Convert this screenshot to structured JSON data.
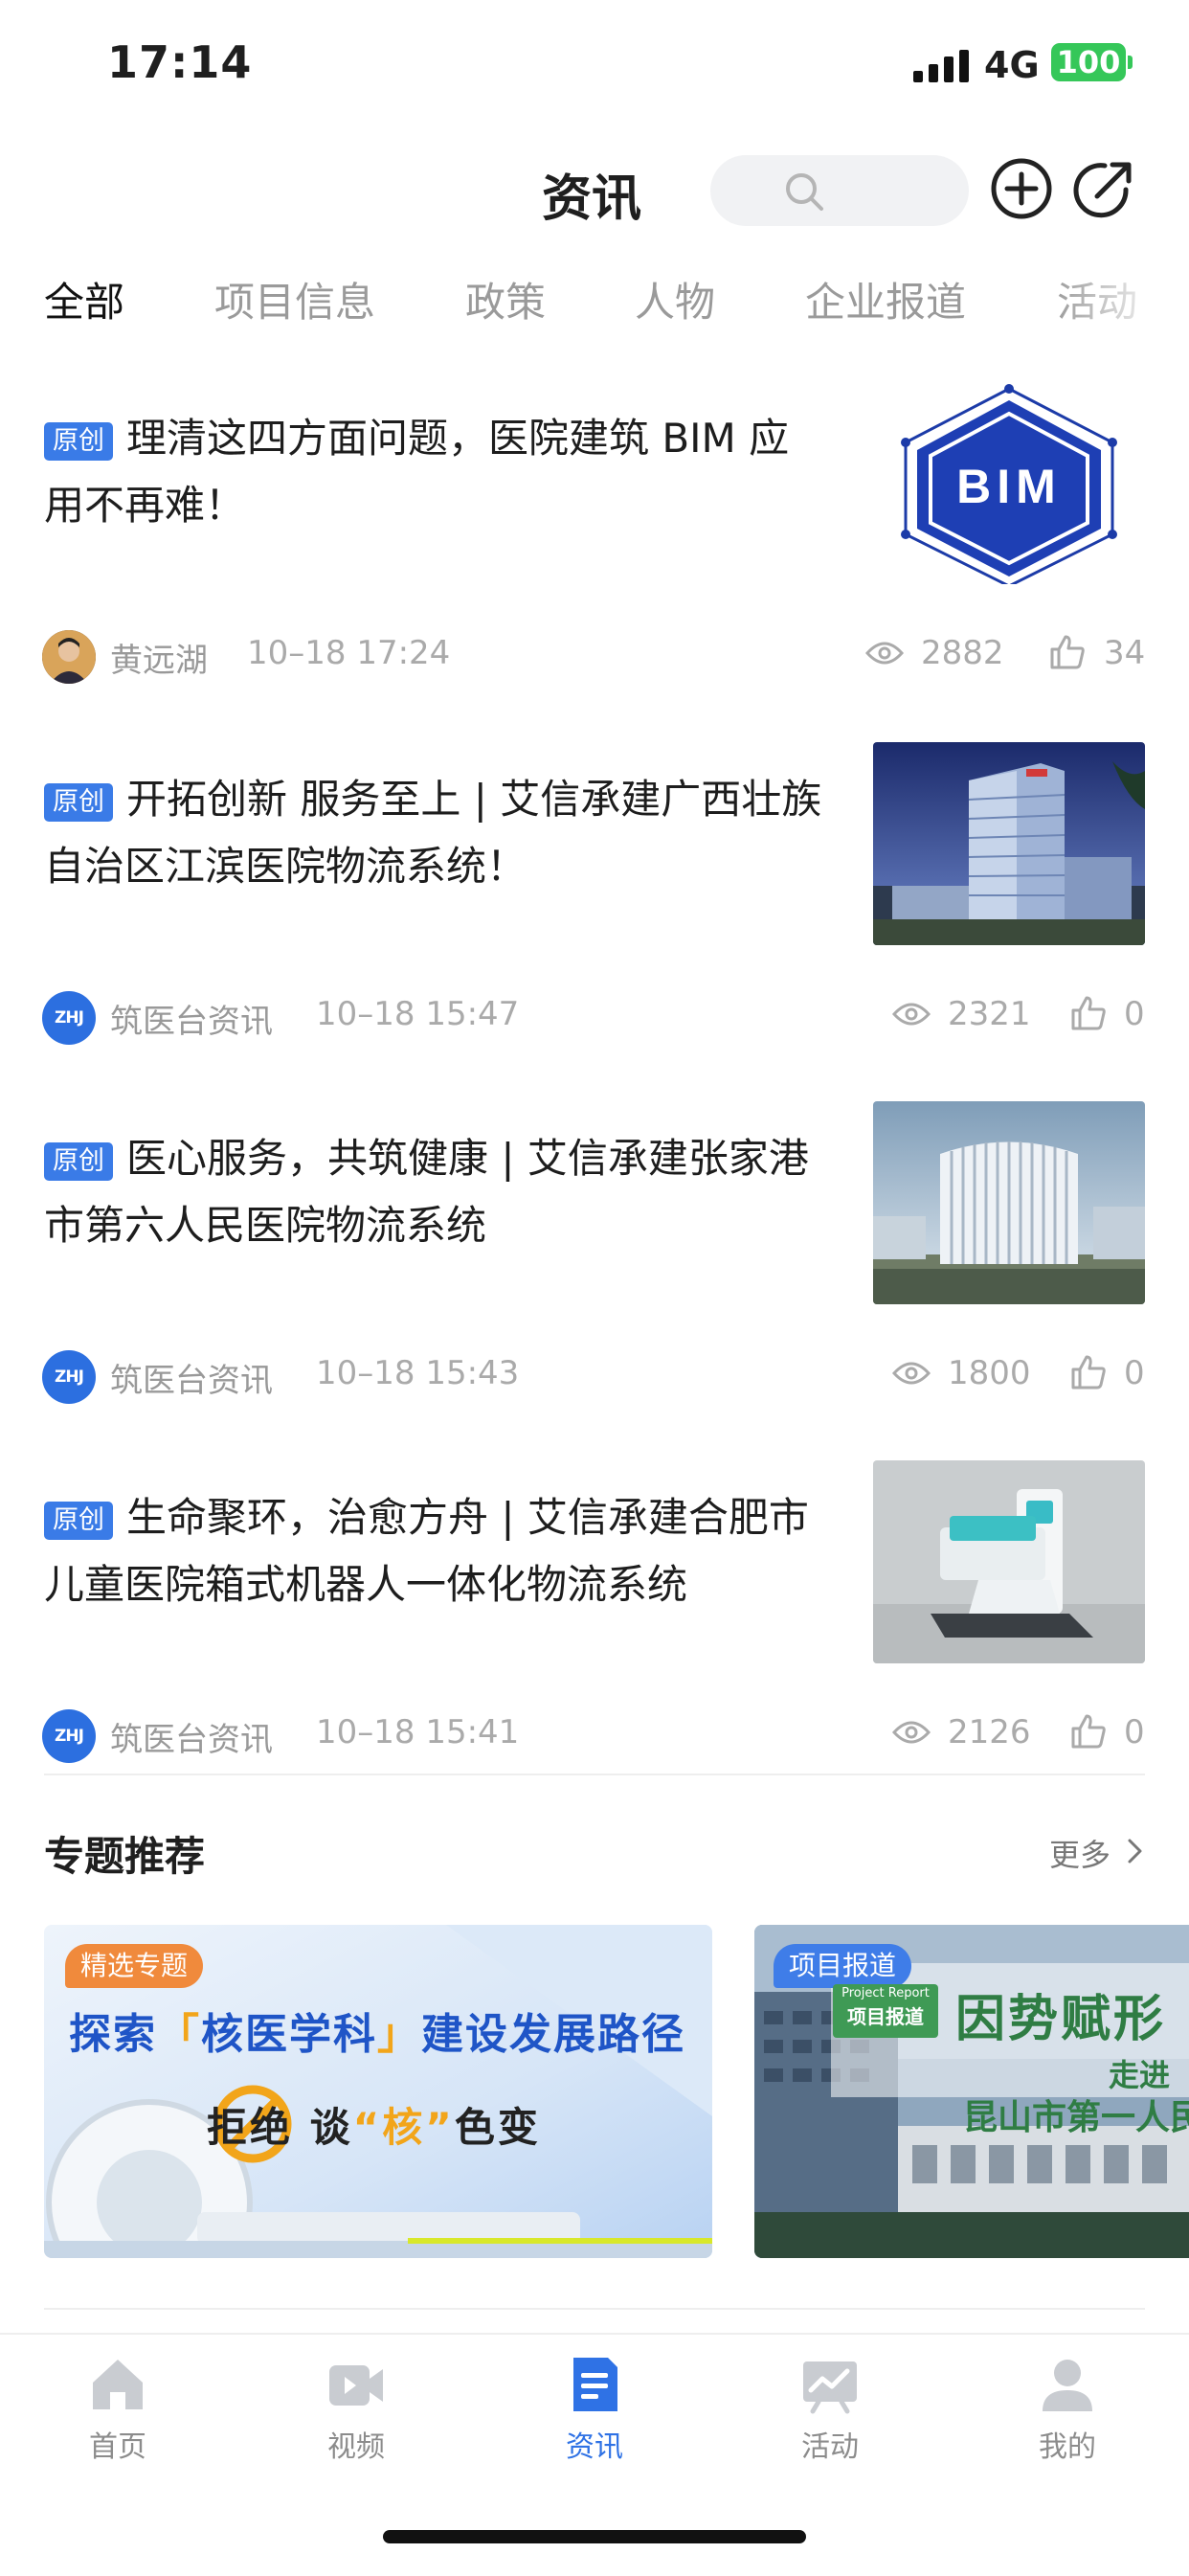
{
  "status_bar": {
    "time": "17:14",
    "network": "4G",
    "battery": "100"
  },
  "header": {
    "title": "资讯",
    "search_placeholder": ""
  },
  "tabs": [
    {
      "label": "全部",
      "active": true
    },
    {
      "label": "项目信息"
    },
    {
      "label": "政策"
    },
    {
      "label": "人物"
    },
    {
      "label": "企业报道"
    },
    {
      "label": "活动"
    }
  ],
  "articles": [
    {
      "badge": "原创",
      "title": "理清这四方面问题，医院建筑 BIM 应用不再难！",
      "author": "黄远湖",
      "time": "10–18 17:24",
      "views": "2882",
      "likes": "34",
      "thumb_text": "BIM"
    },
    {
      "badge": "原创",
      "title": "开拓创新 服务至上 | 艾信承建广西壮族自治区江滨医院物流系统！",
      "author": "筑医台资讯",
      "time": "10–18 15:47",
      "views": "2321",
      "likes": "0"
    },
    {
      "badge": "原创",
      "title": "医心服务，共筑健康 | 艾信承建张家港市第六人民医院物流系统",
      "author": "筑医台资讯",
      "time": "10–18 15:43",
      "views": "1800",
      "likes": "0"
    },
    {
      "badge": "原创",
      "title": "生命聚环，治愈方舟 | 艾信承建合肥市儿童医院箱式机器人一体化物流系统",
      "author": "筑医台资讯",
      "time": "10–18 15:41",
      "views": "2126",
      "likes": "0"
    }
  ],
  "avatar_logo_text": "ZHJ",
  "section": {
    "title": "专题推荐",
    "more": "更多"
  },
  "topics": [
    {
      "badge": "精选专题",
      "headline_pre": "探索",
      "headline_key": "核医学科",
      "headline_post": "建设发展路径",
      "subline_pre": "拒绝 谈",
      "subline_key": "核",
      "subline_post": "色变"
    },
    {
      "badge": "项目报道",
      "tag_en": "Project Report",
      "tag_cn": "项目报道",
      "headline": "因势赋形",
      "sub1": "走进",
      "sub2": "昆山市第一人民"
    }
  ],
  "bottom_nav": [
    {
      "label": "首页",
      "icon": "home-icon"
    },
    {
      "label": "视频",
      "icon": "video-icon"
    },
    {
      "label": "资讯",
      "icon": "news-icon",
      "active": true
    },
    {
      "label": "活动",
      "icon": "activity-icon"
    },
    {
      "label": "我的",
      "icon": "profile-icon"
    }
  ],
  "colors": {
    "accent": "#2f72e5",
    "badge": "#3a7be7",
    "text_primary": "#1d1d1d",
    "text_secondary": "#999999",
    "battery": "#35c759"
  }
}
